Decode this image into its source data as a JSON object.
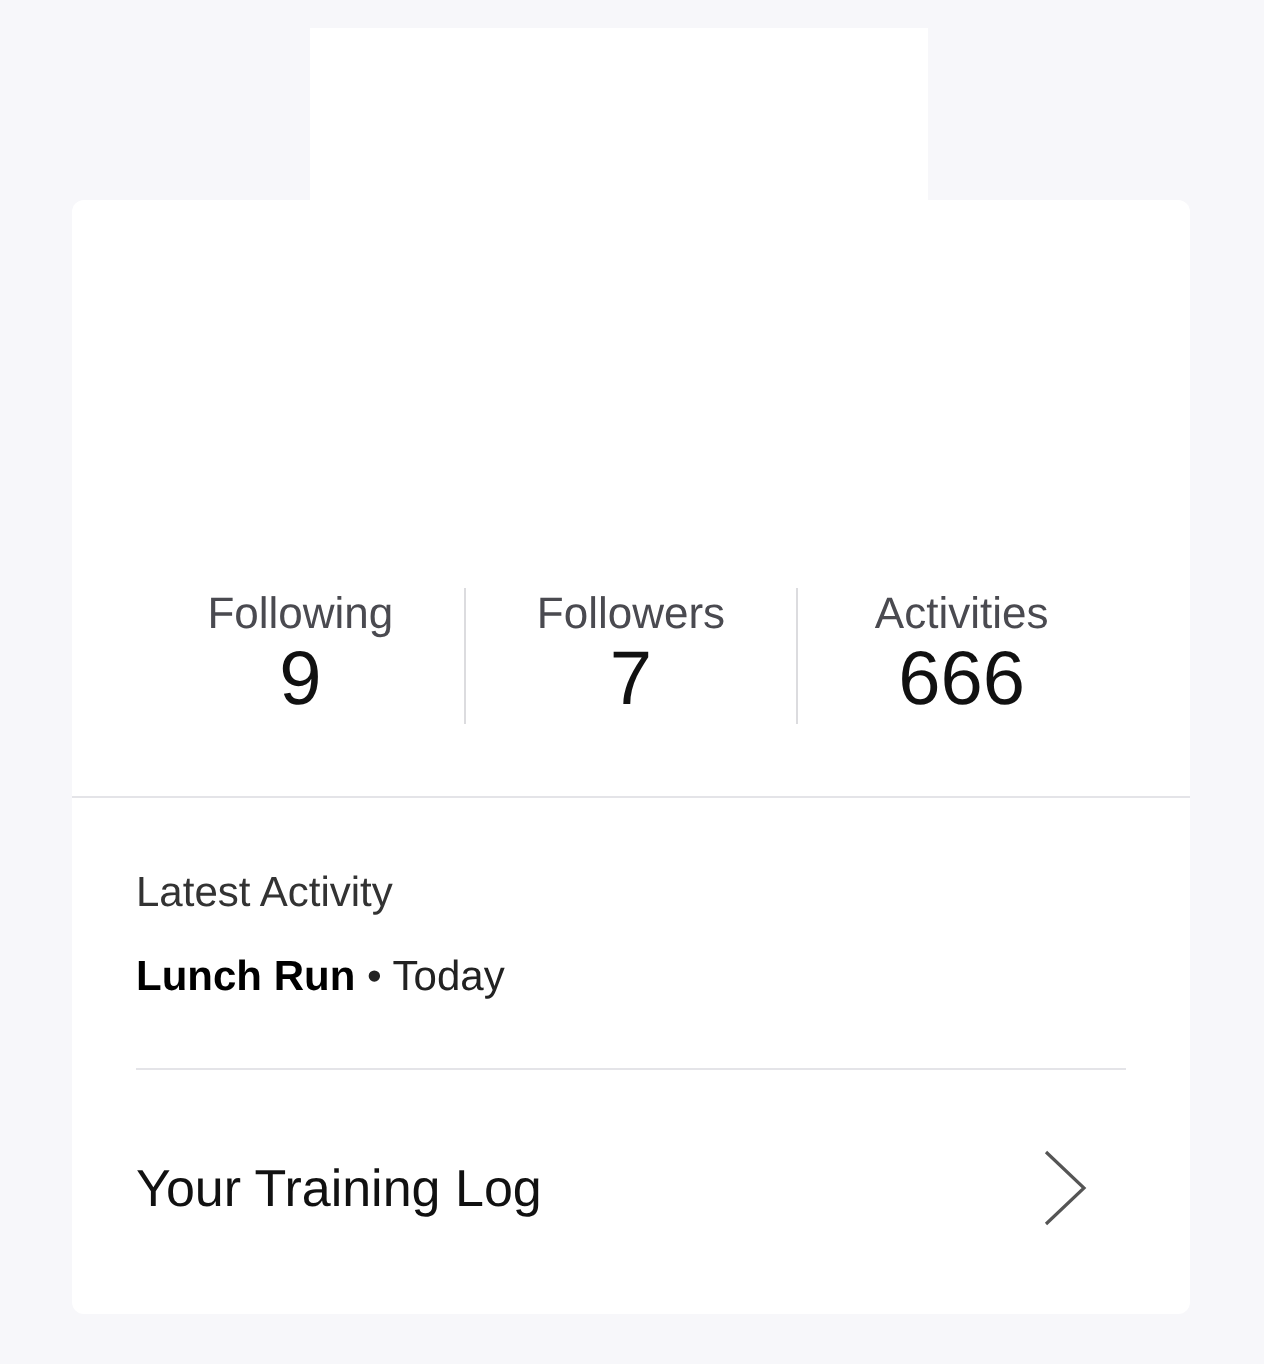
{
  "stats": [
    {
      "label": "Following",
      "value": "9"
    },
    {
      "label": "Followers",
      "value": "7"
    },
    {
      "label": "Activities",
      "value": "666"
    }
  ],
  "latest_activity": {
    "heading": "Latest Activity",
    "summary": "**Lunch Run** • Today"
  },
  "training_log": {
    "label": "Your Training Log"
  }
}
